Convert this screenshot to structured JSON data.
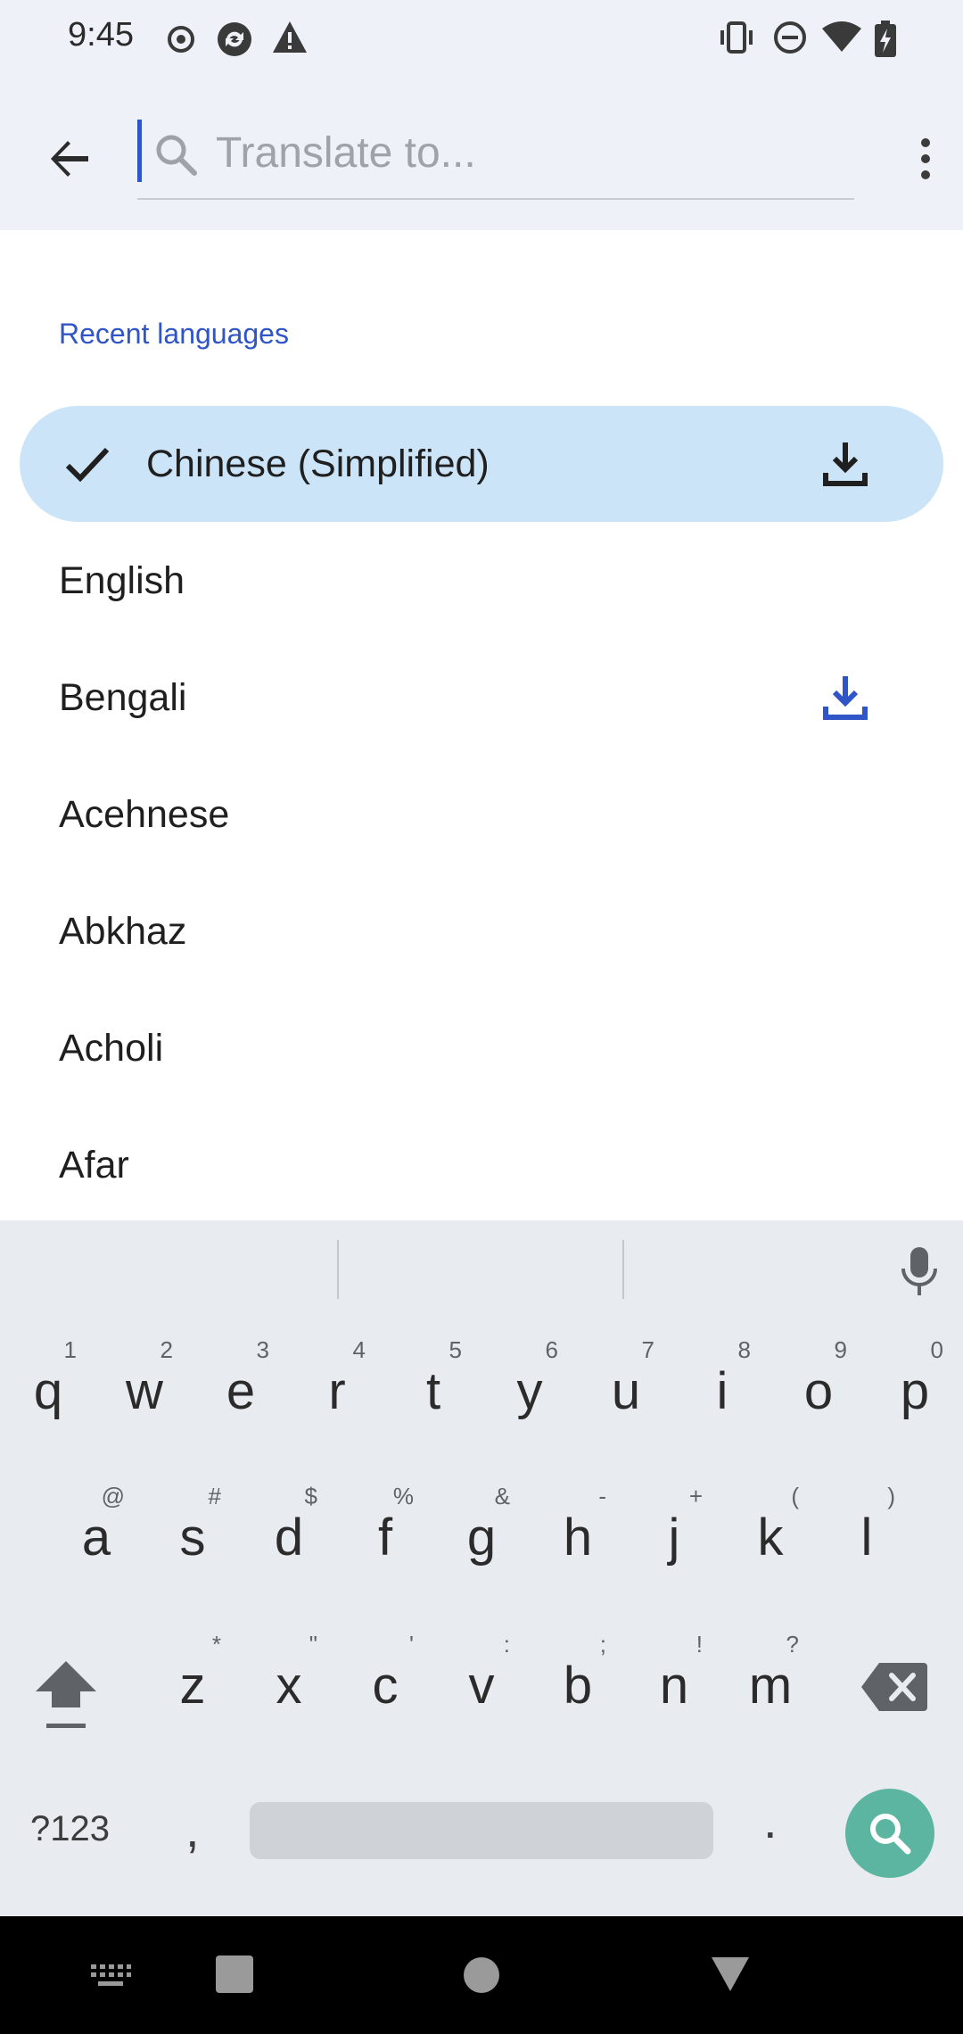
{
  "status": {
    "time": "9:45",
    "left_icons": [
      "record-icon",
      "sync-icon",
      "warning-icon"
    ],
    "right_icons": [
      "vibrate-icon",
      "dnd-icon",
      "wifi-icon",
      "battery-charging-icon"
    ]
  },
  "app_bar": {
    "search_placeholder": "Translate to..."
  },
  "section": {
    "recent_header": "Recent languages"
  },
  "languages": [
    {
      "label": "Chinese (Simplified)",
      "selected": true,
      "download": true
    },
    {
      "label": "English",
      "selected": false,
      "download": false
    },
    {
      "label": "Bengali",
      "selected": false,
      "download": true
    },
    {
      "label": "Acehnese",
      "selected": false,
      "download": false
    },
    {
      "label": "Abkhaz",
      "selected": false,
      "download": false
    },
    {
      "label": "Acholi",
      "selected": false,
      "download": false
    },
    {
      "label": "Afar",
      "selected": false,
      "download": false
    }
  ],
  "keyboard": {
    "row1": [
      [
        "q",
        "1"
      ],
      [
        "w",
        "2"
      ],
      [
        "e",
        "3"
      ],
      [
        "r",
        "4"
      ],
      [
        "t",
        "5"
      ],
      [
        "y",
        "6"
      ],
      [
        "u",
        "7"
      ],
      [
        "i",
        "8"
      ],
      [
        "o",
        "9"
      ],
      [
        "p",
        "0"
      ]
    ],
    "row2": [
      [
        "a",
        "@"
      ],
      [
        "s",
        "#"
      ],
      [
        "d",
        "$"
      ],
      [
        "f",
        "%"
      ],
      [
        "g",
        "&"
      ],
      [
        "h",
        "-"
      ],
      [
        "j",
        "+"
      ],
      [
        "k",
        "("
      ],
      [
        "l",
        ")"
      ]
    ],
    "row3": [
      [
        "z",
        "*"
      ],
      [
        "x",
        "\""
      ],
      [
        "c",
        "'"
      ],
      [
        "v",
        ":"
      ],
      [
        "b",
        ";"
      ],
      [
        "n",
        "!"
      ],
      [
        "m",
        "?"
      ]
    ],
    "symbols_label": "?123",
    "comma": ",",
    "period": ".",
    "colors": {
      "search_key": "#5bb5a0",
      "accent": "#2f55c8",
      "selected_pill": "#cce4f8"
    }
  }
}
